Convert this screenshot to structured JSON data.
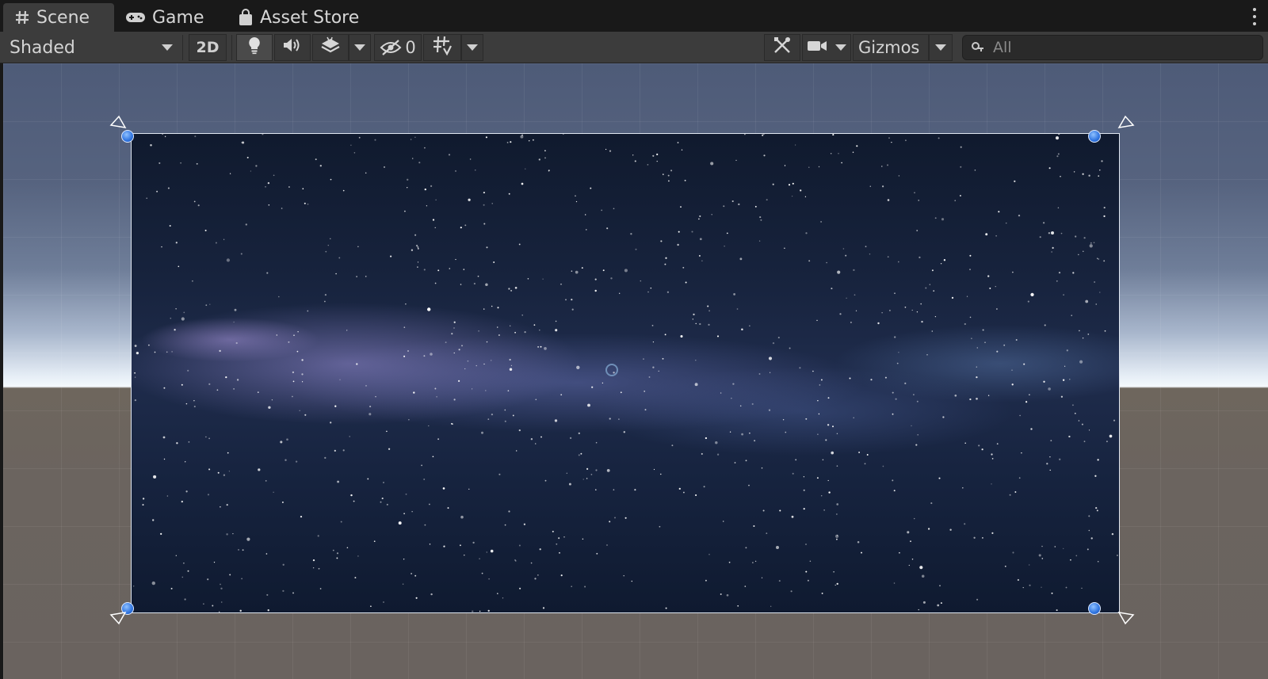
{
  "tabs": [
    {
      "label": "Scene",
      "icon": "grid-hash-icon",
      "active": true
    },
    {
      "label": "Game",
      "icon": "gamepad-icon",
      "active": false
    },
    {
      "label": "Asset Store",
      "icon": "shopping-bag-icon",
      "active": false
    }
  ],
  "toolbar": {
    "draw_mode": "Shaded",
    "mode_2d_label": "2D",
    "hidden_count": "0",
    "gizmos_label": "Gizmos",
    "search_placeholder": "All"
  },
  "icons": {
    "lighting": "lightbulb-icon",
    "audio": "speaker-icon",
    "effects": "layers-icon",
    "visibility": "eye-slash-icon",
    "grid": "grid-snap-icon",
    "tools": "tools-icon",
    "camera": "camera-icon",
    "search": "search-icon",
    "menu": "kebab-menu-icon"
  },
  "colors": {
    "handle_blue": "#2f74e0",
    "panel_bg": "#3c3c3c",
    "tab_bar_bg": "#191919"
  }
}
